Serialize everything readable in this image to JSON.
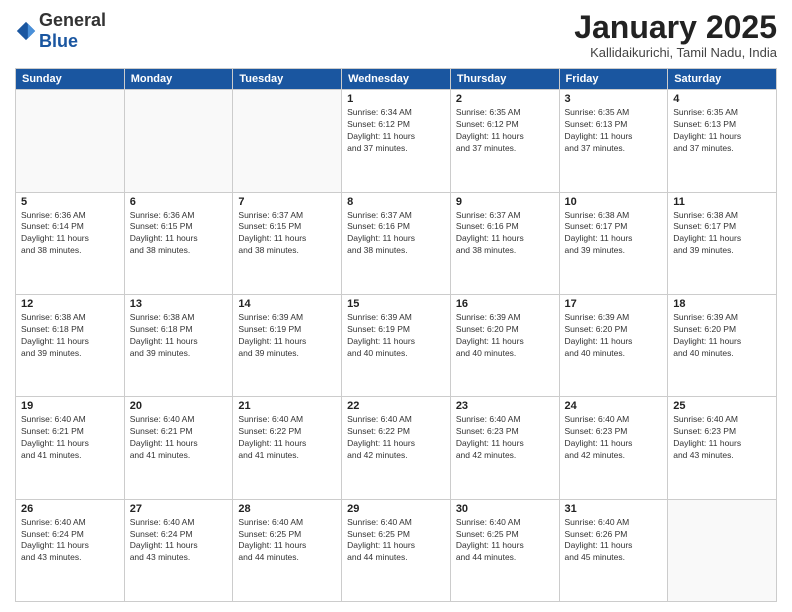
{
  "logo": {
    "general": "General",
    "blue": "Blue"
  },
  "header": {
    "month": "January 2025",
    "location": "Kallidaikurichi, Tamil Nadu, India"
  },
  "weekdays": [
    "Sunday",
    "Monday",
    "Tuesday",
    "Wednesday",
    "Thursday",
    "Friday",
    "Saturday"
  ],
  "weeks": [
    [
      {
        "day": "",
        "info": ""
      },
      {
        "day": "",
        "info": ""
      },
      {
        "day": "",
        "info": ""
      },
      {
        "day": "1",
        "info": "Sunrise: 6:34 AM\nSunset: 6:12 PM\nDaylight: 11 hours\nand 37 minutes."
      },
      {
        "day": "2",
        "info": "Sunrise: 6:35 AM\nSunset: 6:12 PM\nDaylight: 11 hours\nand 37 minutes."
      },
      {
        "day": "3",
        "info": "Sunrise: 6:35 AM\nSunset: 6:13 PM\nDaylight: 11 hours\nand 37 minutes."
      },
      {
        "day": "4",
        "info": "Sunrise: 6:35 AM\nSunset: 6:13 PM\nDaylight: 11 hours\nand 37 minutes."
      }
    ],
    [
      {
        "day": "5",
        "info": "Sunrise: 6:36 AM\nSunset: 6:14 PM\nDaylight: 11 hours\nand 38 minutes."
      },
      {
        "day": "6",
        "info": "Sunrise: 6:36 AM\nSunset: 6:15 PM\nDaylight: 11 hours\nand 38 minutes."
      },
      {
        "day": "7",
        "info": "Sunrise: 6:37 AM\nSunset: 6:15 PM\nDaylight: 11 hours\nand 38 minutes."
      },
      {
        "day": "8",
        "info": "Sunrise: 6:37 AM\nSunset: 6:16 PM\nDaylight: 11 hours\nand 38 minutes."
      },
      {
        "day": "9",
        "info": "Sunrise: 6:37 AM\nSunset: 6:16 PM\nDaylight: 11 hours\nand 38 minutes."
      },
      {
        "day": "10",
        "info": "Sunrise: 6:38 AM\nSunset: 6:17 PM\nDaylight: 11 hours\nand 39 minutes."
      },
      {
        "day": "11",
        "info": "Sunrise: 6:38 AM\nSunset: 6:17 PM\nDaylight: 11 hours\nand 39 minutes."
      }
    ],
    [
      {
        "day": "12",
        "info": "Sunrise: 6:38 AM\nSunset: 6:18 PM\nDaylight: 11 hours\nand 39 minutes."
      },
      {
        "day": "13",
        "info": "Sunrise: 6:38 AM\nSunset: 6:18 PM\nDaylight: 11 hours\nand 39 minutes."
      },
      {
        "day": "14",
        "info": "Sunrise: 6:39 AM\nSunset: 6:19 PM\nDaylight: 11 hours\nand 39 minutes."
      },
      {
        "day": "15",
        "info": "Sunrise: 6:39 AM\nSunset: 6:19 PM\nDaylight: 11 hours\nand 40 minutes."
      },
      {
        "day": "16",
        "info": "Sunrise: 6:39 AM\nSunset: 6:20 PM\nDaylight: 11 hours\nand 40 minutes."
      },
      {
        "day": "17",
        "info": "Sunrise: 6:39 AM\nSunset: 6:20 PM\nDaylight: 11 hours\nand 40 minutes."
      },
      {
        "day": "18",
        "info": "Sunrise: 6:39 AM\nSunset: 6:20 PM\nDaylight: 11 hours\nand 40 minutes."
      }
    ],
    [
      {
        "day": "19",
        "info": "Sunrise: 6:40 AM\nSunset: 6:21 PM\nDaylight: 11 hours\nand 41 minutes."
      },
      {
        "day": "20",
        "info": "Sunrise: 6:40 AM\nSunset: 6:21 PM\nDaylight: 11 hours\nand 41 minutes."
      },
      {
        "day": "21",
        "info": "Sunrise: 6:40 AM\nSunset: 6:22 PM\nDaylight: 11 hours\nand 41 minutes."
      },
      {
        "day": "22",
        "info": "Sunrise: 6:40 AM\nSunset: 6:22 PM\nDaylight: 11 hours\nand 42 minutes."
      },
      {
        "day": "23",
        "info": "Sunrise: 6:40 AM\nSunset: 6:23 PM\nDaylight: 11 hours\nand 42 minutes."
      },
      {
        "day": "24",
        "info": "Sunrise: 6:40 AM\nSunset: 6:23 PM\nDaylight: 11 hours\nand 42 minutes."
      },
      {
        "day": "25",
        "info": "Sunrise: 6:40 AM\nSunset: 6:23 PM\nDaylight: 11 hours\nand 43 minutes."
      }
    ],
    [
      {
        "day": "26",
        "info": "Sunrise: 6:40 AM\nSunset: 6:24 PM\nDaylight: 11 hours\nand 43 minutes."
      },
      {
        "day": "27",
        "info": "Sunrise: 6:40 AM\nSunset: 6:24 PM\nDaylight: 11 hours\nand 43 minutes."
      },
      {
        "day": "28",
        "info": "Sunrise: 6:40 AM\nSunset: 6:25 PM\nDaylight: 11 hours\nand 44 minutes."
      },
      {
        "day": "29",
        "info": "Sunrise: 6:40 AM\nSunset: 6:25 PM\nDaylight: 11 hours\nand 44 minutes."
      },
      {
        "day": "30",
        "info": "Sunrise: 6:40 AM\nSunset: 6:25 PM\nDaylight: 11 hours\nand 44 minutes."
      },
      {
        "day": "31",
        "info": "Sunrise: 6:40 AM\nSunset: 6:26 PM\nDaylight: 11 hours\nand 45 minutes."
      },
      {
        "day": "",
        "info": ""
      }
    ]
  ]
}
